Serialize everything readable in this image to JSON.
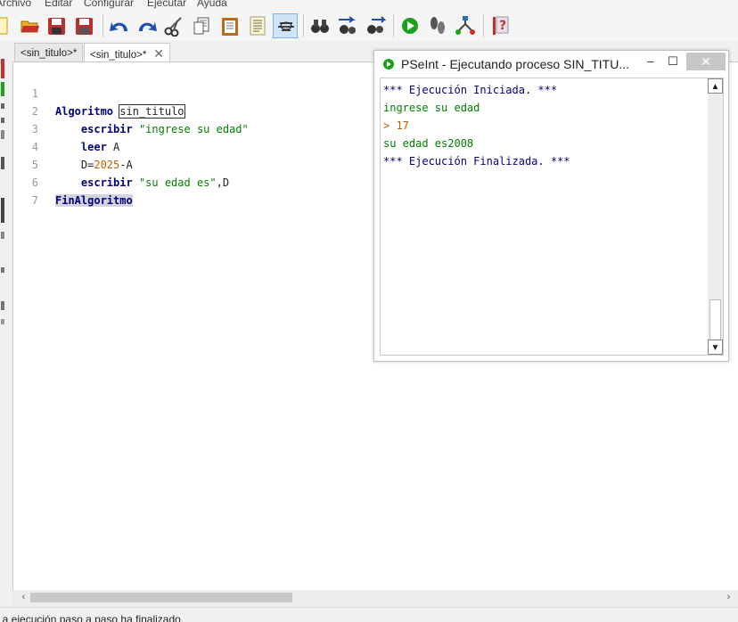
{
  "menu": [
    "Archivo",
    "Editar",
    "Configurar",
    "Ejecutar",
    "Ayuda"
  ],
  "toolbar": {
    "buttons": [
      "new-file",
      "open-folder",
      "save",
      "save-as",
      "undo",
      "redo",
      "cut",
      "copy",
      "paste",
      "indent",
      "toggle-view",
      "search",
      "find-next",
      "replace",
      "run",
      "step",
      "flowchart",
      "help"
    ]
  },
  "tabs": [
    {
      "label": "<sin_titulo>*"
    },
    {
      "label": "<sin_titulo>*",
      "close": "✕"
    }
  ],
  "editor": {
    "line_numbers": [
      "1",
      "2",
      "3",
      "4",
      "5",
      "6",
      "7"
    ],
    "lines": [
      {
        "kw1": "Algoritmo",
        "name": "sin_titulo"
      },
      {
        "kw1": "escribir",
        "str": "\"ingrese su edad\""
      },
      {
        "kw1": "leer",
        "rest": "A"
      },
      {
        "lhs": "D=",
        "num": "2025",
        "rest": "-A"
      },
      {
        "kw1": "escribir",
        "str": "\"su edad es\"",
        "rest": ",D"
      },
      {
        "kw1": "FinAlgoritmo"
      },
      {}
    ]
  },
  "run_window": {
    "title": "PSeInt - Ejecutando proceso SIN_TITU...",
    "controls": {
      "minimize": "–",
      "maximize": "☐",
      "close": "✕"
    },
    "output": [
      {
        "text": "*** Ejecución Iniciada. ***",
        "kind": "sys"
      },
      {
        "text": "ingrese su edad",
        "kind": "user"
      },
      {
        "text": "> 17",
        "kind": "input"
      },
      {
        "text": "su edad es2008",
        "kind": "user"
      },
      {
        "text": "*** Ejecución Finalizada. ***",
        "kind": "sys"
      }
    ]
  },
  "scroll": {
    "left": "‹",
    "right": "›",
    "up": "▲",
    "down": "▼"
  },
  "status": "La ejecución paso a paso ha finalizado.",
  "colors": {
    "keyword": "#000080",
    "string": "#008000",
    "number": "#c06000",
    "run_green": "#1aa31a"
  }
}
